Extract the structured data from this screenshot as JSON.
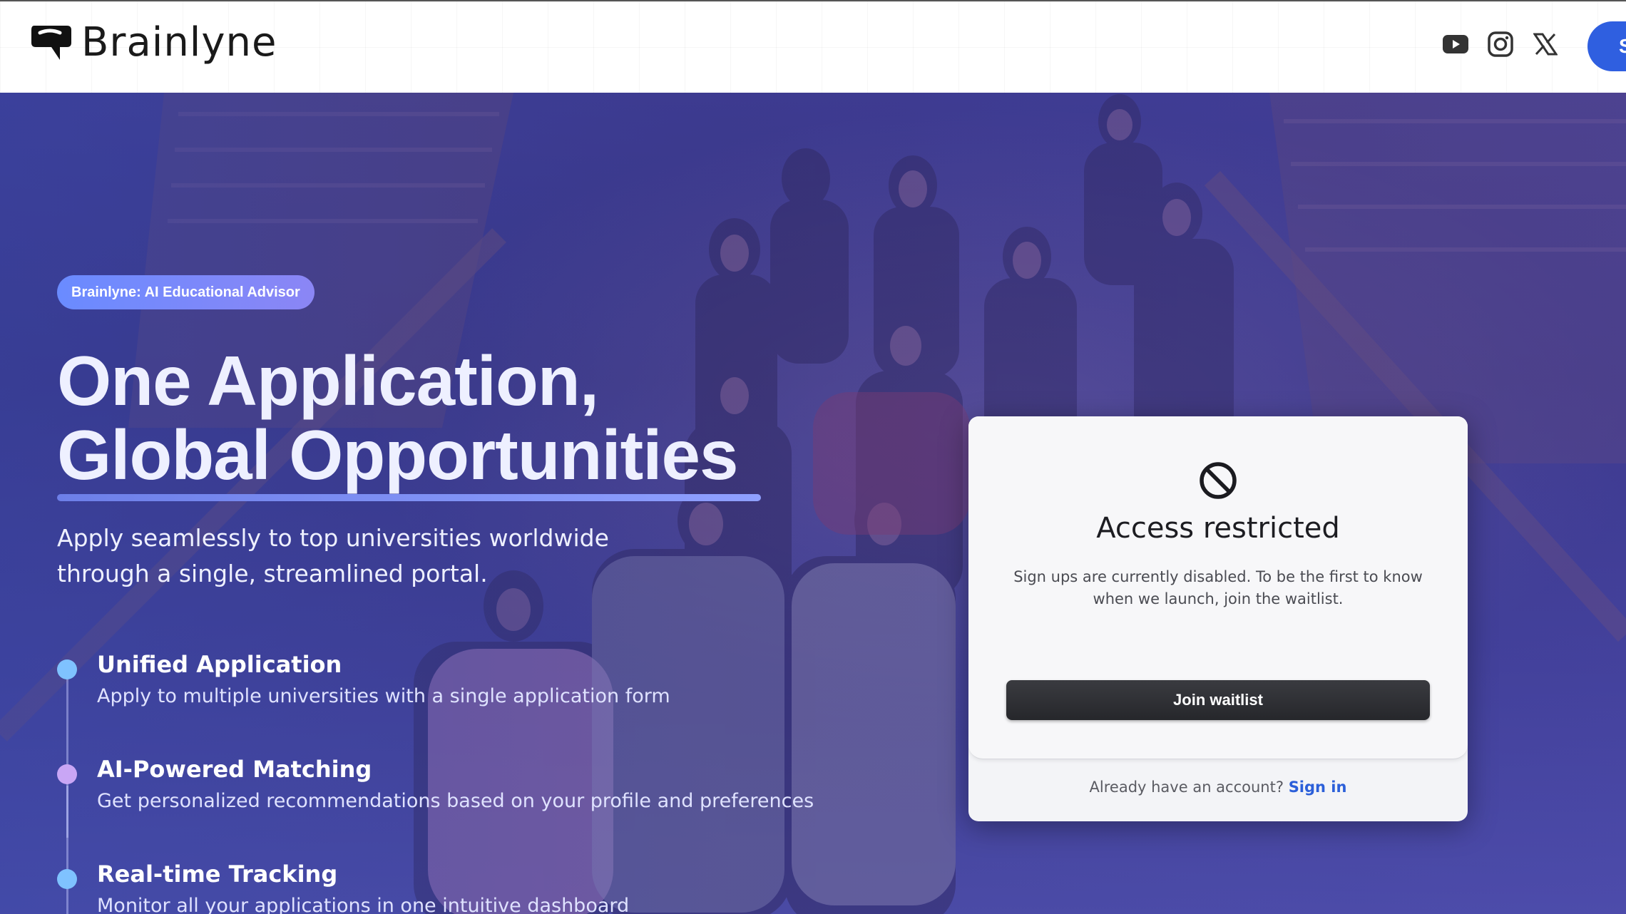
{
  "header": {
    "brand": "Brainlyne",
    "cta_label": "S",
    "social": [
      "youtube-icon",
      "instagram-icon",
      "x-icon"
    ]
  },
  "hero": {
    "badge": "Brainlyne: AI Educational Advisor",
    "headline_line1": "One Application,",
    "headline_line2": "Global Opportunities",
    "subhead": "Apply seamlessly to top universities worldwide through a single, streamlined portal.",
    "features": [
      {
        "title": "Unified Application",
        "desc": "Apply to multiple universities with a single application form",
        "color": "#7fc2ff"
      },
      {
        "title": "AI-Powered Matching",
        "desc": "Get personalized recommendations based on your profile and preferences",
        "color": "#c9a6f5"
      },
      {
        "title": "Real-time Tracking",
        "desc": "Monitor all your applications in one intuitive dashboard",
        "color": "#7fc2ff"
      }
    ]
  },
  "modal": {
    "icon": "ban-icon",
    "title": "Access restricted",
    "body": "Sign ups are currently disabled. To be the first to know when we launch, join the waitlist.",
    "button": "Join waitlist",
    "footer_prefix": "Already have an account?",
    "footer_link": "Sign in"
  },
  "colors": {
    "accent": "#2f5fe0",
    "button_dark": "#2a2b30",
    "link": "#2b5fd9"
  }
}
